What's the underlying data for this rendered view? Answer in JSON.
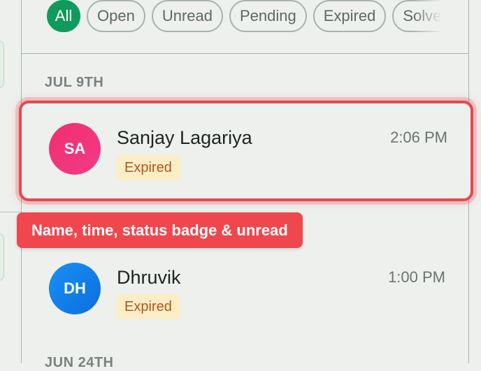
{
  "filters": {
    "chips": [
      {
        "label": "All",
        "active": true
      },
      {
        "label": "Open",
        "active": false
      },
      {
        "label": "Unread",
        "active": false
      },
      {
        "label": "Pending",
        "active": false
      },
      {
        "label": "Expired",
        "active": false
      },
      {
        "label": "Solved",
        "active": false
      }
    ]
  },
  "groups": [
    {
      "date": "JUL 9TH"
    },
    {
      "date": "JUN 24TH"
    }
  ],
  "conversations": [
    {
      "initials": "SA",
      "name": "Sanjay Lagariya",
      "time": "2:06 PM",
      "status": "Expired",
      "avatar_color": "#f0306f"
    },
    {
      "initials": "DH",
      "name": "Dhruvik",
      "time": "1:00 PM",
      "status": "Expired",
      "avatar_color": "#1a8ff2"
    }
  ],
  "tooltip": {
    "text": "Name, time, status badge & unread"
  },
  "colors": {
    "accent": "#0f9b5d",
    "highlight": "#e8474f",
    "badge_bg": "#fbeec6",
    "badge_text": "#b4541a"
  }
}
